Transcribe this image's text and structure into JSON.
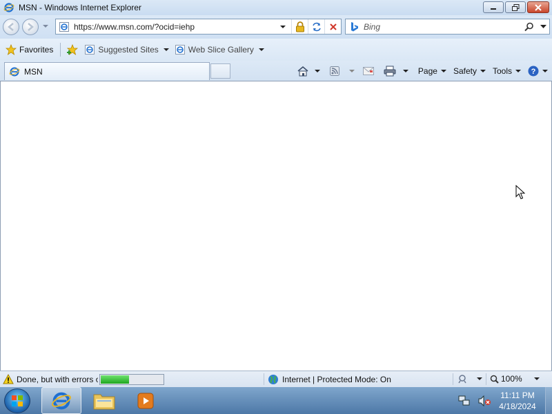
{
  "window": {
    "title": "MSN - Windows Internet Explorer",
    "minimize_icon": "minimize-icon",
    "restore_icon": "restore-icon",
    "close_icon": "close-icon"
  },
  "navigation": {
    "address_url": "https://www.msn.com/?ocid=iehp",
    "search_placeholder": "Bing"
  },
  "favorites_bar": {
    "favorites_label": "Favorites",
    "suggested_sites_label": "Suggested Sites",
    "web_slice_gallery_label": "Web Slice Gallery"
  },
  "tabs": [
    {
      "label": "MSN"
    }
  ],
  "command_bar": {
    "page_label": "Page",
    "safety_label": "Safety",
    "tools_label": "Tools"
  },
  "status_bar": {
    "status_text": "Done, but with errors o",
    "progress": 0.45,
    "zone_text": "Internet | Protected Mode: On",
    "zoom_text": "100%"
  },
  "taskbar": {
    "time": "11:11 PM",
    "date": "4/18/2024"
  },
  "colors": {
    "chrome_light": "#dbe8f6",
    "taskbar": "#4d78a7",
    "progress_green": "#1fa61f",
    "close_red": "#c9462c"
  }
}
